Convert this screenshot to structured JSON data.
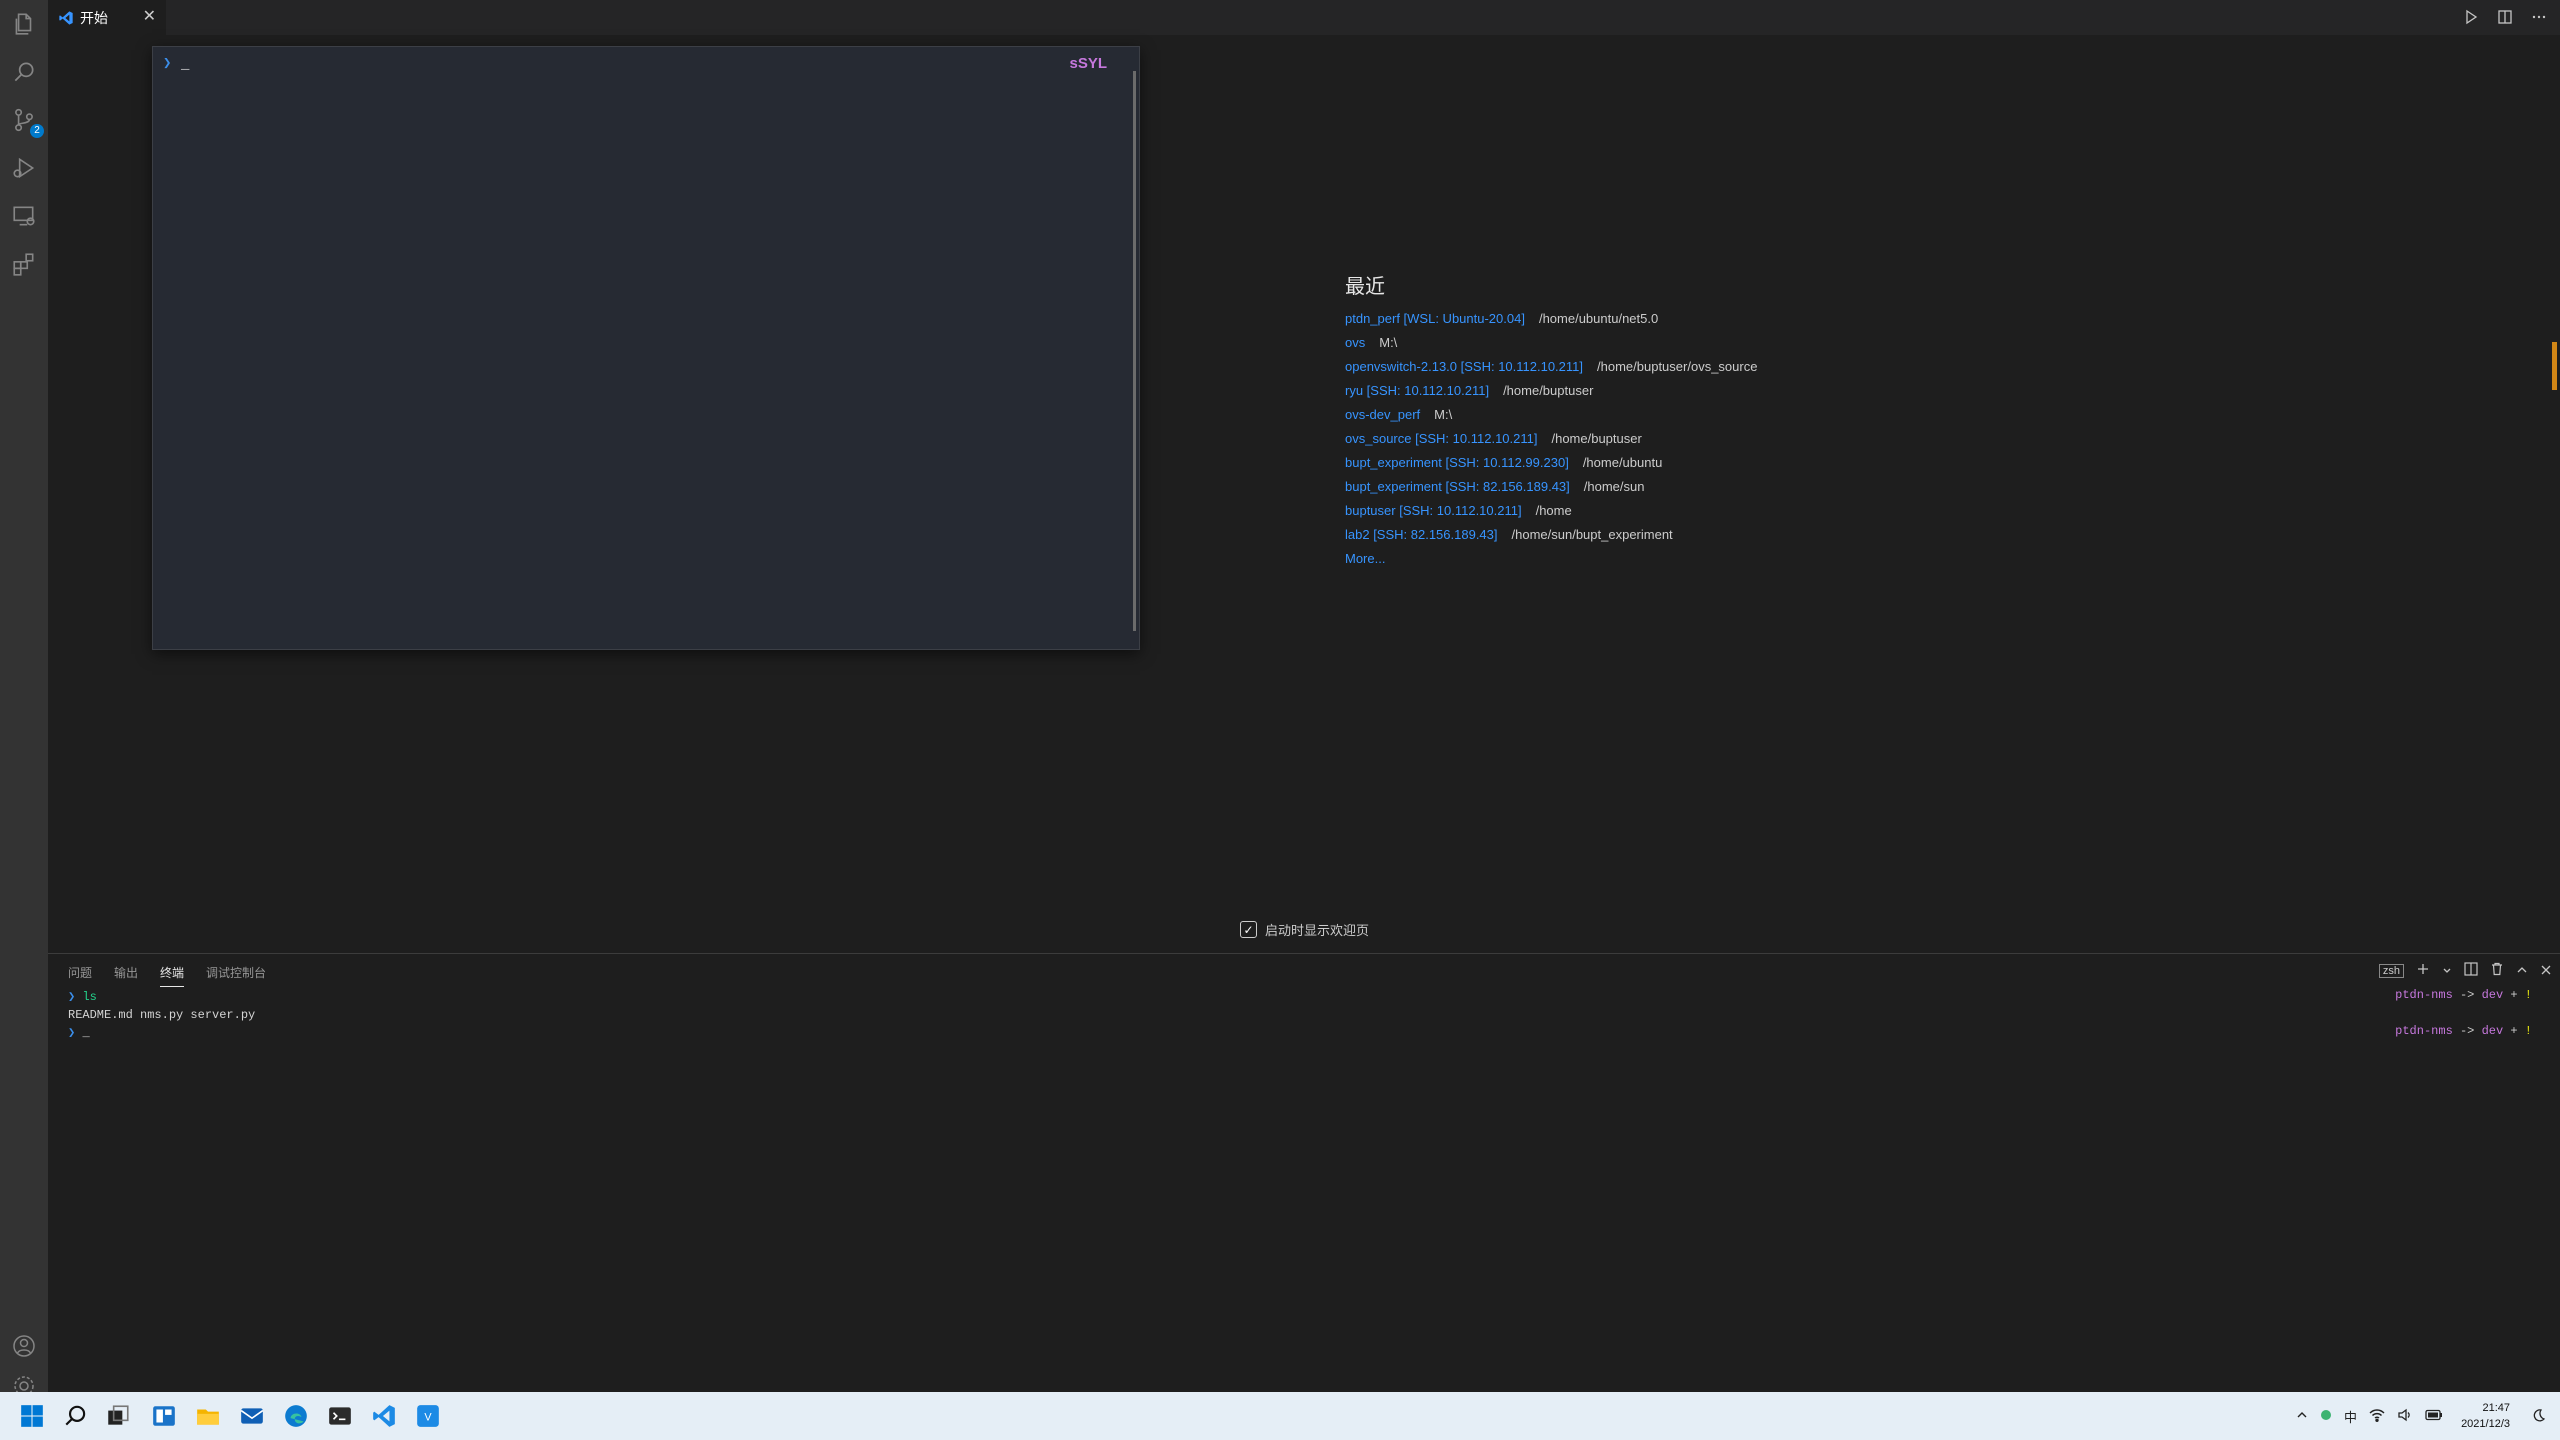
{
  "tabs": [
    {
      "label": "开始",
      "close": "✕"
    }
  ],
  "activity_bar": {
    "source_control_badge": "2"
  },
  "welcome": {
    "recent_heading": "最近",
    "recent": [
      {
        "name": "ptdn_perf [WSL: Ubuntu-20.04]",
        "path": "/home/ubuntu/net5.0"
      },
      {
        "name": "ovs",
        "path": "M:\\"
      },
      {
        "name": "openvswitch-2.13.0 [SSH: 10.112.10.211]",
        "path": "/home/buptuser/ovs_source"
      },
      {
        "name": "ryu [SSH: 10.112.10.211]",
        "path": "/home/buptuser"
      },
      {
        "name": "ovs-dev_perf",
        "path": "M:\\"
      },
      {
        "name": "ovs_source [SSH: 10.112.10.211]",
        "path": "/home/buptuser"
      },
      {
        "name": "bupt_experiment [SSH: 10.112.99.230]",
        "path": "/home/ubuntu"
      },
      {
        "name": "bupt_experiment [SSH: 82.156.189.43]",
        "path": "/home/sun"
      },
      {
        "name": "buptuser [SSH: 10.112.10.211]",
        "path": "/home"
      },
      {
        "name": "lab2 [SSH: 82.156.189.43]",
        "path": "/home/sun/bupt_experiment"
      }
    ],
    "more": "More...",
    "show_on_startup": "启动时显示欢迎页",
    "show_on_startup_checked": true
  },
  "floating_terminal": {
    "prompt": "❯",
    "cursor": "_",
    "title": "sSYL"
  },
  "panel": {
    "tabs": [
      "问题",
      "输出",
      "终端",
      "调试控制台"
    ],
    "active_tab": "终端",
    "shell": "zsh",
    "terminal": {
      "prompt": "❯",
      "command": "ls",
      "output": "README.md  nms.py  server.py",
      "cursor": "_",
      "right_prompt": {
        "name": "ptdn-nms",
        "arrow": "->",
        "branch": "dev",
        "plus": "+",
        "bang": "!"
      }
    }
  },
  "taskbar": {
    "input_method": "中",
    "time": "21:47",
    "date": "2021/12/3"
  },
  "colors": {
    "accent": "#007acc",
    "link": "#3794ff",
    "terminal_purple": "#c678dd",
    "ruler_mark": "#d18616"
  }
}
